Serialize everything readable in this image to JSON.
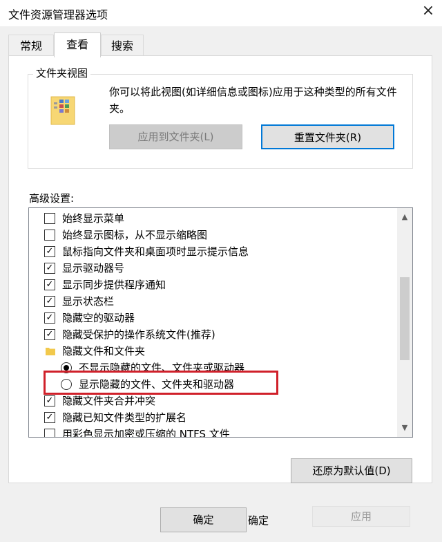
{
  "window": {
    "title": "文件资源管理器选项",
    "close_glyph": "×"
  },
  "tabs": [
    {
      "label": "常规",
      "active": false
    },
    {
      "label": "查看",
      "active": true
    },
    {
      "label": "搜索",
      "active": false
    }
  ],
  "folder_view": {
    "group_title": "文件夹视图",
    "description": "你可以将此视图(如详细信息或图标)应用于这种类型的所有文件夹。",
    "apply_button": "应用到文件夹(L)",
    "reset_button": "重置文件夹(R)"
  },
  "advanced": {
    "label": "高级设置:",
    "items": [
      {
        "type": "checkbox",
        "checked": false,
        "label": "始终显示菜单"
      },
      {
        "type": "checkbox",
        "checked": false,
        "label": "始终显示图标，从不显示缩略图"
      },
      {
        "type": "checkbox",
        "checked": true,
        "label": "鼠标指向文件夹和桌面项时显示提示信息"
      },
      {
        "type": "checkbox",
        "checked": true,
        "label": "显示驱动器号"
      },
      {
        "type": "checkbox",
        "checked": true,
        "label": "显示同步提供程序通知"
      },
      {
        "type": "checkbox",
        "checked": true,
        "label": "显示状态栏"
      },
      {
        "type": "checkbox",
        "checked": true,
        "label": "隐藏空的驱动器"
      },
      {
        "type": "checkbox",
        "checked": true,
        "label": "隐藏受保护的操作系统文件(推荐)"
      },
      {
        "type": "folder",
        "label": "隐藏文件和文件夹"
      },
      {
        "type": "radio",
        "checked": true,
        "label": "不显示隐藏的文件、文件夹或驱动器"
      },
      {
        "type": "radio",
        "checked": false,
        "label": "显示隐藏的文件、文件夹和驱动器"
      },
      {
        "type": "checkbox",
        "checked": true,
        "label": "隐藏文件夹合并冲突"
      },
      {
        "type": "checkbox",
        "checked": true,
        "label": "隐藏已知文件类型的扩展名"
      },
      {
        "type": "checkbox",
        "checked": false,
        "label": "用彩色显示加密或压缩的 NTFS 文件"
      }
    ]
  },
  "buttons": {
    "restore_defaults": "还原为默认值(D)",
    "ok": "确定",
    "ok_overlay": "确定",
    "faded": "应用"
  },
  "colors": {
    "highlight_box": "#d0202a",
    "focus_border": "#0078d7"
  },
  "icons": {
    "checkmark": "✓",
    "scroll_up": "▲",
    "scroll_down": "▼"
  }
}
